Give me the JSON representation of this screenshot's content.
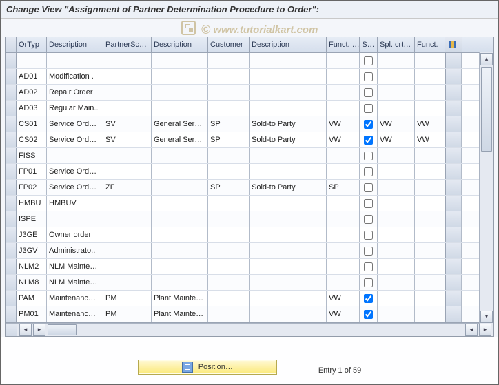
{
  "window": {
    "title": "Change View \"Assignment of Partner Determination Procedure to Order\":"
  },
  "watermark": "www.tutorialkart.com",
  "table": {
    "columns": [
      "OrTyp",
      "Description",
      "PartnerSc…",
      "Description",
      "Customer",
      "Description",
      "Funct. …",
      "S…",
      "Spl. crt…",
      "Funct."
    ],
    "config_icon": "column-config-icon",
    "rows": [
      {
        "ortyp": "",
        "desc1": "",
        "psc": "",
        "desc2": "",
        "cust": "",
        "desc3": "",
        "funct": "",
        "chk": false,
        "spl": "",
        "funct2": ""
      },
      {
        "ortyp": "AD01",
        "desc1": "Modification .",
        "psc": "",
        "desc2": "",
        "cust": "",
        "desc3": "",
        "funct": "",
        "chk": false,
        "spl": "",
        "funct2": ""
      },
      {
        "ortyp": "AD02",
        "desc1": "Repair Order",
        "psc": "",
        "desc2": "",
        "cust": "",
        "desc3": "",
        "funct": "",
        "chk": false,
        "spl": "",
        "funct2": ""
      },
      {
        "ortyp": "AD03",
        "desc1": "Regular Main..",
        "psc": "",
        "desc2": "",
        "cust": "",
        "desc3": "",
        "funct": "",
        "chk": false,
        "spl": "",
        "funct2": ""
      },
      {
        "ortyp": "CS01",
        "desc1": "Service Ord…",
        "psc": "SV",
        "desc2": "General Ser…",
        "cust": "SP",
        "desc3": "Sold-to Party",
        "funct": "VW",
        "chk": true,
        "spl": "VW",
        "funct2": "VW"
      },
      {
        "ortyp": "CS02",
        "desc1": "Service Ord…",
        "psc": "SV",
        "desc2": "General Ser…",
        "cust": "SP",
        "desc3": "Sold-to Party",
        "funct": "VW",
        "chk": true,
        "spl": "VW",
        "funct2": "VW"
      },
      {
        "ortyp": "FISS",
        "desc1": "",
        "psc": "",
        "desc2": "",
        "cust": "",
        "desc3": "",
        "funct": "",
        "chk": false,
        "spl": "",
        "funct2": ""
      },
      {
        "ortyp": "FP01",
        "desc1": "Service Ord…",
        "psc": "",
        "desc2": "",
        "cust": "",
        "desc3": "",
        "funct": "",
        "chk": false,
        "spl": "",
        "funct2": ""
      },
      {
        "ortyp": "FP02",
        "desc1": "Service Ord…",
        "psc": "ZF",
        "desc2": "",
        "cust": "SP",
        "desc3": "Sold-to Party",
        "funct": "SP",
        "chk": false,
        "spl": "",
        "funct2": ""
      },
      {
        "ortyp": "HMBU",
        "desc1": "HMBUV",
        "psc": "",
        "desc2": "",
        "cust": "",
        "desc3": "",
        "funct": "",
        "chk": false,
        "spl": "",
        "funct2": ""
      },
      {
        "ortyp": "ISPE",
        "desc1": "",
        "psc": "",
        "desc2": "",
        "cust": "",
        "desc3": "",
        "funct": "",
        "chk": false,
        "spl": "",
        "funct2": ""
      },
      {
        "ortyp": "J3GE",
        "desc1": "Owner order",
        "psc": "",
        "desc2": "",
        "cust": "",
        "desc3": "",
        "funct": "",
        "chk": false,
        "spl": "",
        "funct2": ""
      },
      {
        "ortyp": "J3GV",
        "desc1": "Administrato..",
        "psc": "",
        "desc2": "",
        "cust": "",
        "desc3": "",
        "funct": "",
        "chk": false,
        "spl": "",
        "funct2": ""
      },
      {
        "ortyp": "NLM2",
        "desc1": "NLM Mainte…",
        "psc": "",
        "desc2": "",
        "cust": "",
        "desc3": "",
        "funct": "",
        "chk": false,
        "spl": "",
        "funct2": ""
      },
      {
        "ortyp": "NLM8",
        "desc1": "NLM Mainte…",
        "psc": "",
        "desc2": "",
        "cust": "",
        "desc3": "",
        "funct": "",
        "chk": false,
        "spl": "",
        "funct2": ""
      },
      {
        "ortyp": "PAM",
        "desc1": "Maintenanc…",
        "psc": "PM",
        "desc2": "Plant Mainte…",
        "cust": "",
        "desc3": "",
        "funct": "VW",
        "chk": true,
        "spl": "",
        "funct2": ""
      },
      {
        "ortyp": "PM01",
        "desc1": "Maintenanc…",
        "psc": "PM",
        "desc2": "Plant Mainte…",
        "cust": "",
        "desc3": "",
        "funct": "VW",
        "chk": true,
        "spl": "",
        "funct2": ""
      }
    ]
  },
  "footer": {
    "position_button": "Position…",
    "entry_text": "Entry 1 of 59"
  }
}
